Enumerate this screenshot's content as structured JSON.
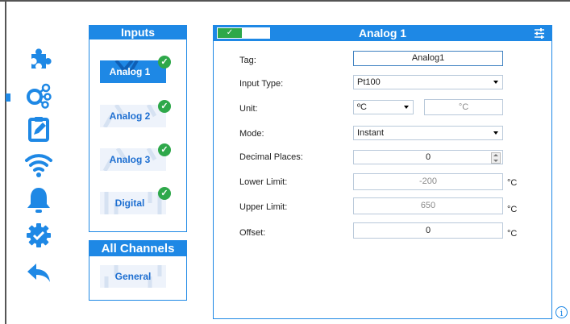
{
  "colors": {
    "accent": "#1e88e5",
    "success": "#2ea84a"
  },
  "rail": {
    "icons": [
      "puzzle-icon",
      "inputs-network-icon",
      "clipboard-edit-icon",
      "wifi-icon",
      "bell-icon",
      "gear-check-icon",
      "back-arrow-icon"
    ]
  },
  "inputs_panel": {
    "title": "Inputs",
    "items": [
      {
        "label": "Analog 1",
        "active": true
      },
      {
        "label": "Analog 2",
        "active": false
      },
      {
        "label": "Analog 3",
        "active": false
      },
      {
        "label": "Digital",
        "active": false
      }
    ],
    "check_glyph": "✓"
  },
  "channels_panel": {
    "title": "All Channels",
    "items": [
      {
        "label": "General"
      }
    ]
  },
  "detail": {
    "title": "Analog 1",
    "toggle_glyph": "✓",
    "fields": {
      "tag": {
        "label": "Tag:",
        "value": "Analog1"
      },
      "input_type": {
        "label": "Input Type:",
        "value": "Pt100"
      },
      "unit": {
        "label": "Unit:",
        "value": "ºC",
        "display": "°C"
      },
      "mode": {
        "label": "Mode:",
        "value": "Instant"
      },
      "decimal_places": {
        "label": "Decimal Places:",
        "value": "0"
      },
      "lower_limit": {
        "label": "Lower Limit:",
        "value": "-200",
        "suffix": "°C"
      },
      "upper_limit": {
        "label": "Upper Limit:",
        "value": "650",
        "suffix": "°C"
      },
      "offset": {
        "label": "Offset:",
        "value": "0",
        "suffix": "°C"
      }
    }
  },
  "info_glyph": "i"
}
